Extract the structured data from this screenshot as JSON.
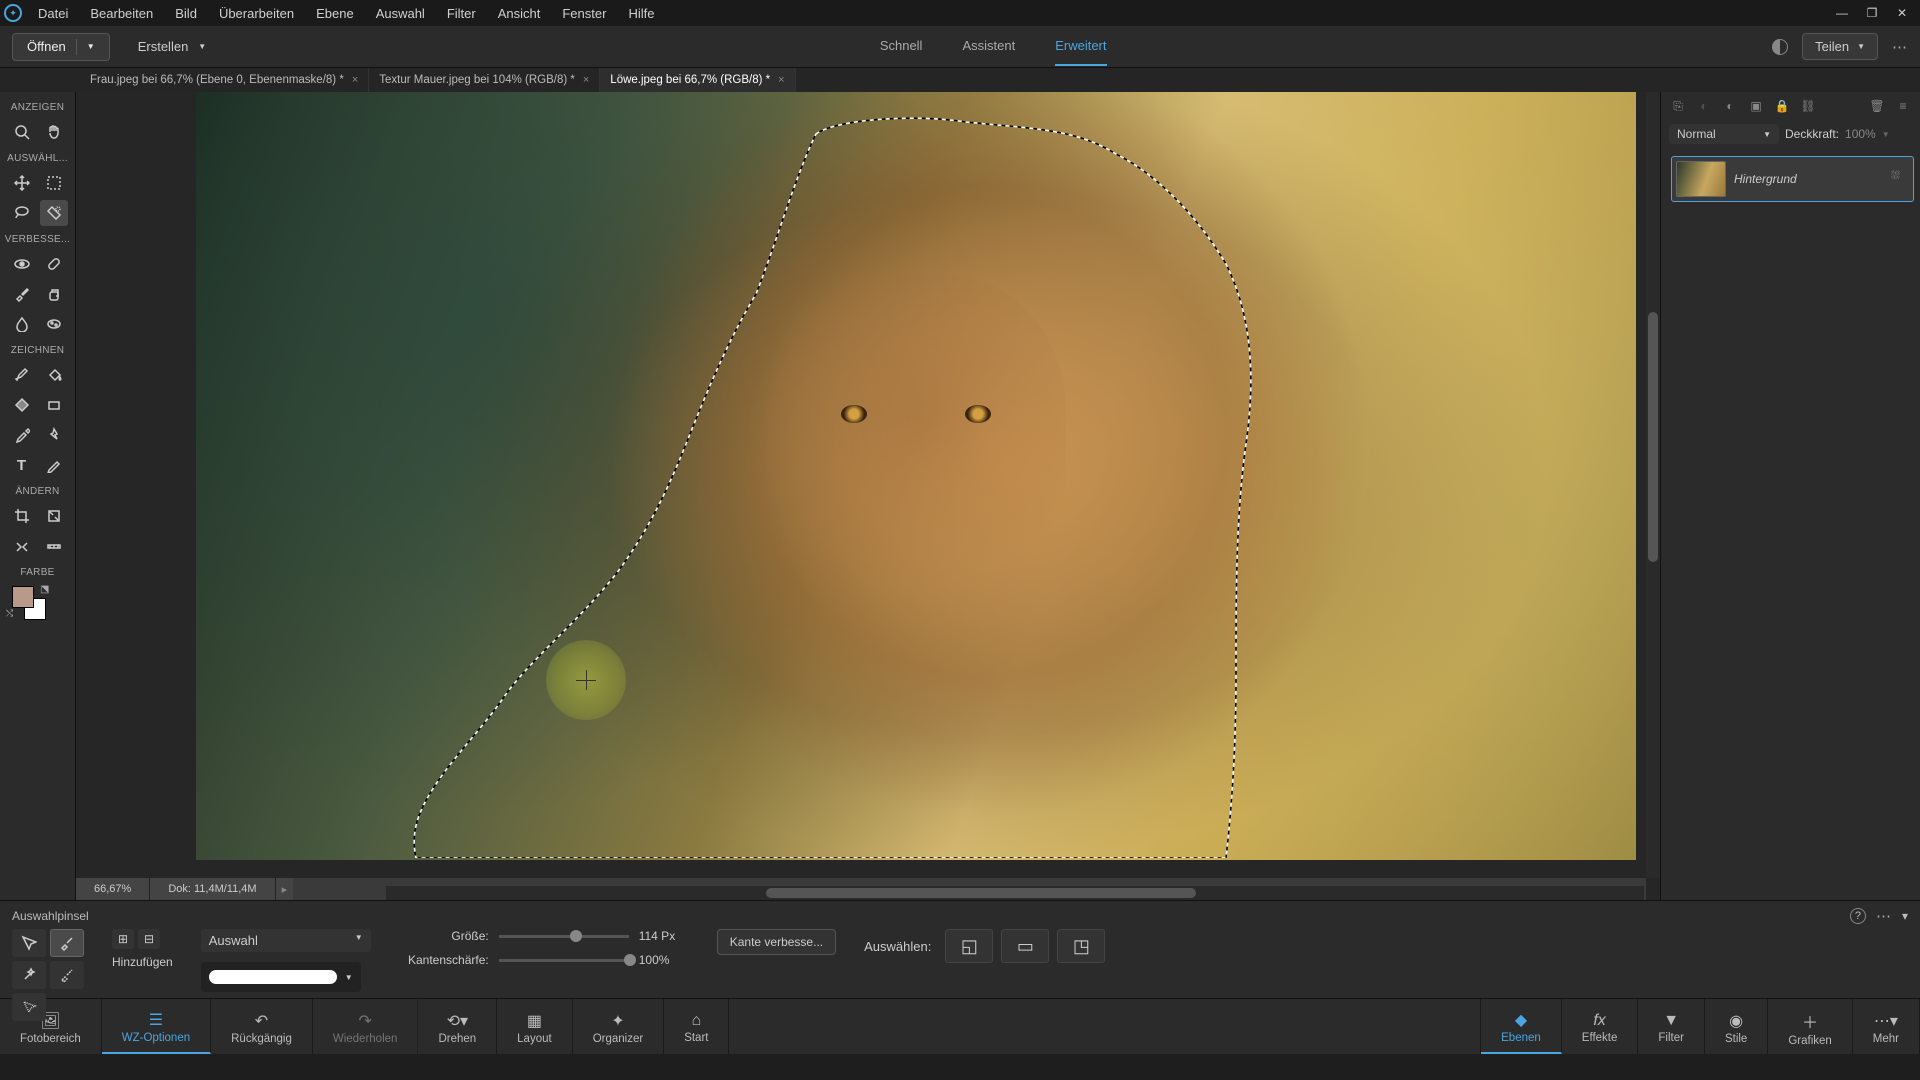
{
  "menu": [
    "Datei",
    "Bearbeiten",
    "Bild",
    "Überarbeiten",
    "Ebene",
    "Auswahl",
    "Filter",
    "Ansicht",
    "Fenster",
    "Hilfe"
  ],
  "actionbar": {
    "open": "Öffnen",
    "create": "Erstellen",
    "modes": {
      "quick": "Schnell",
      "guided": "Assistent",
      "expert": "Erweitert"
    },
    "share": "Teilen"
  },
  "tabs": [
    {
      "title": "Frau.jpeg bei 66,7% (Ebene 0, Ebenenmaske/8) *",
      "active": false
    },
    {
      "title": "Textur Mauer.jpeg bei 104% (RGB/8) *",
      "active": false
    },
    {
      "title": "Löwe.jpeg bei 66,7% (RGB/8) *",
      "active": true
    }
  ],
  "toolgroups": {
    "view": "ANZEIGEN",
    "select": "AUSWÄHL...",
    "enhance": "VERBESSE...",
    "draw": "ZEICHNEN",
    "modify": "ÄNDERN",
    "color": "FARBE"
  },
  "status": {
    "zoom": "66,67%",
    "docinfo": "Dok: 11,4M/11,4M"
  },
  "layerspanel": {
    "blendmode": "Normal",
    "opacity_label": "Deckkraft:",
    "opacity_value": "100%",
    "layer_name": "Hintergrund"
  },
  "tooloptions": {
    "tool_name": "Auswahlpinsel",
    "add_label": "Hinzufügen",
    "mode_label": "Auswahl",
    "size_label": "Größe:",
    "size_value": "114 Px",
    "feather_label": "Kantenschärfe:",
    "feather_value": "100%",
    "refine": "Kante verbesse...",
    "select_label": "Auswählen:"
  },
  "bottombar": {
    "photobin": "Fotobereich",
    "toolopts": "WZ-Optionen",
    "undo": "Rückgängig",
    "redo": "Wiederholen",
    "rotate": "Drehen",
    "layout": "Layout",
    "organizer": "Organizer",
    "home": "Start",
    "layers": "Ebenen",
    "effects": "Effekte",
    "filters": "Filter",
    "styles": "Stile",
    "graphics": "Grafiken",
    "more": "Mehr"
  },
  "colors": {
    "accent": "#4aa5e0",
    "fg": "#b8998a",
    "bg": "#ffffff"
  }
}
